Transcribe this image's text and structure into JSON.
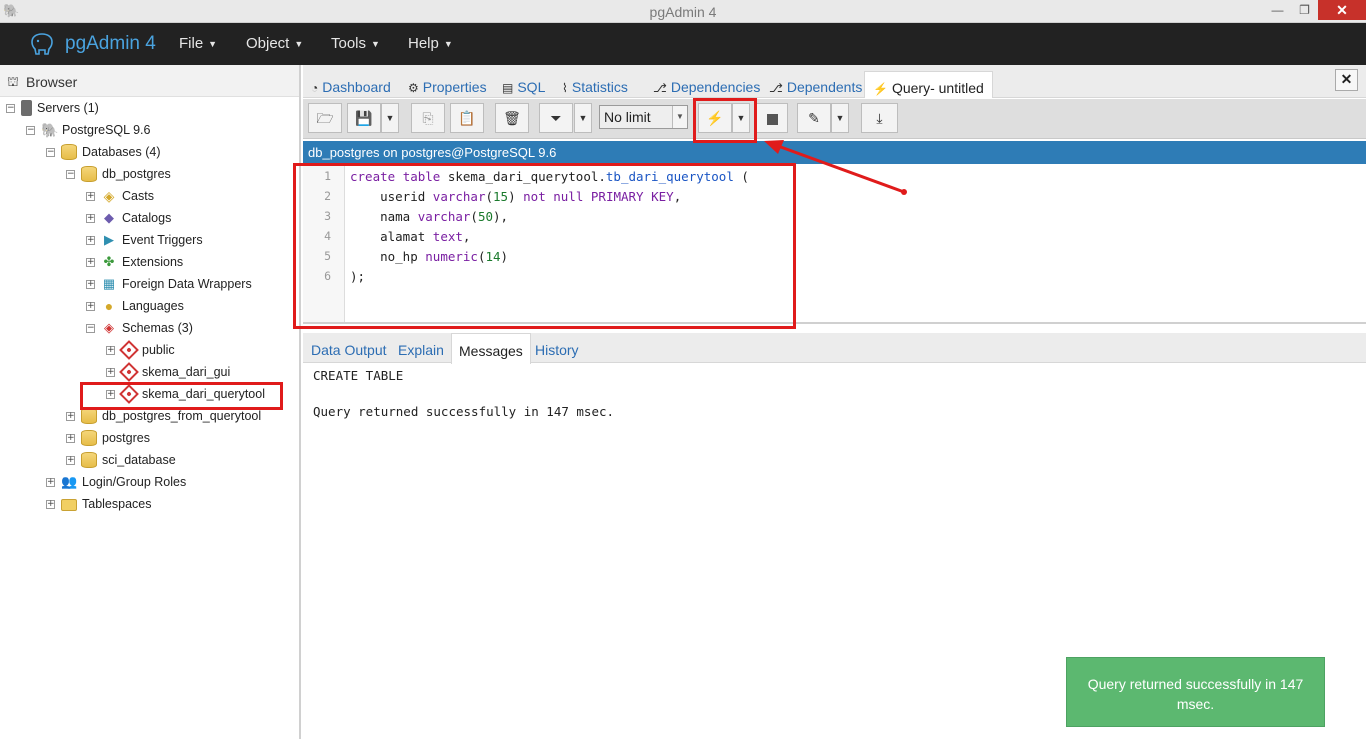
{
  "window": {
    "title": "pgAdmin 4",
    "min_label": "—",
    "max_label": "❐",
    "close_label": "✕"
  },
  "navbar": {
    "brand": "pgAdmin 4",
    "menus": [
      {
        "label": "File"
      },
      {
        "label": "Object"
      },
      {
        "label": "Tools"
      },
      {
        "label": "Help"
      }
    ]
  },
  "browser": {
    "title": "Browser",
    "tree": [
      {
        "label": "Servers (1)",
        "toggle": "⊟",
        "icon": "server-icon"
      },
      {
        "label": "PostgreSQL 9.6",
        "toggle": "⊟",
        "icon": "postgresql-elephant-icon"
      },
      {
        "label": "Databases (4)",
        "toggle": "⊟",
        "icon": "databases-icon"
      },
      {
        "label": "db_postgres",
        "toggle": "⊟",
        "icon": "database-icon"
      },
      {
        "label": "Casts",
        "toggle": "⊞",
        "icon": "casts-icon"
      },
      {
        "label": "Catalogs",
        "toggle": "⊞",
        "icon": "catalogs-icon"
      },
      {
        "label": "Event Triggers",
        "toggle": "⊞",
        "icon": "event-triggers-icon"
      },
      {
        "label": "Extensions",
        "toggle": "⊞",
        "icon": "extensions-icon"
      },
      {
        "label": "Foreign Data Wrappers",
        "toggle": "⊞",
        "icon": "foreign-data-wrappers-icon"
      },
      {
        "label": "Languages",
        "toggle": "⊞",
        "icon": "languages-icon"
      },
      {
        "label": "Schemas (3)",
        "toggle": "⊟",
        "icon": "schemas-icon"
      },
      {
        "label": "public",
        "toggle": "⊞",
        "icon": "schema-icon"
      },
      {
        "label": "skema_dari_gui",
        "toggle": "⊞",
        "icon": "schema-icon"
      },
      {
        "label": "skema_dari_querytool",
        "toggle": "⊞",
        "icon": "schema-icon"
      },
      {
        "label": "db_postgres_from_querytool",
        "toggle": "⊞",
        "icon": "database-icon"
      },
      {
        "label": "postgres",
        "toggle": "⊞",
        "icon": "database-icon"
      },
      {
        "label": "sci_database",
        "toggle": "⊞",
        "icon": "database-icon"
      },
      {
        "label": "Login/Group Roles",
        "toggle": "⊞",
        "icon": "login-roles-icon"
      },
      {
        "label": "Tablespaces",
        "toggle": "⊞",
        "icon": "tablespaces-icon"
      }
    ]
  },
  "tabs": [
    {
      "label": "Dashboard",
      "icon": "dashboard-icon"
    },
    {
      "label": "Properties",
      "icon": "properties-icon"
    },
    {
      "label": "SQL",
      "icon": "sql-icon"
    },
    {
      "label": "Statistics",
      "icon": "statistics-icon"
    },
    {
      "label": "Dependencies",
      "icon": "dependencies-icon"
    },
    {
      "label": "Dependents",
      "icon": "dependents-icon"
    },
    {
      "label": "Query- untitled",
      "icon": "lightning-icon",
      "active": true
    }
  ],
  "toolbar": {
    "limit_value": "No limit"
  },
  "connection": "db_postgres on postgres@PostgreSQL 9.6",
  "editor": {
    "line_numbers": [
      "1",
      "2",
      "3",
      "4",
      "5",
      "6"
    ]
  },
  "result_tabs": [
    {
      "label": "Data Output"
    },
    {
      "label": "Explain"
    },
    {
      "label": "Messages",
      "active": true
    },
    {
      "label": "History"
    }
  ],
  "messages": {
    "line1": "CREATE TABLE",
    "line2": "Query returned successfully in 147 msec."
  },
  "toast": "Query returned successfully in 147 msec.",
  "colors": {
    "navbar": "#222222",
    "brand": "#4aa3df",
    "connection_bar": "#2e7cb6",
    "toast": "#5cb870",
    "annotation": "#e01b1b"
  }
}
